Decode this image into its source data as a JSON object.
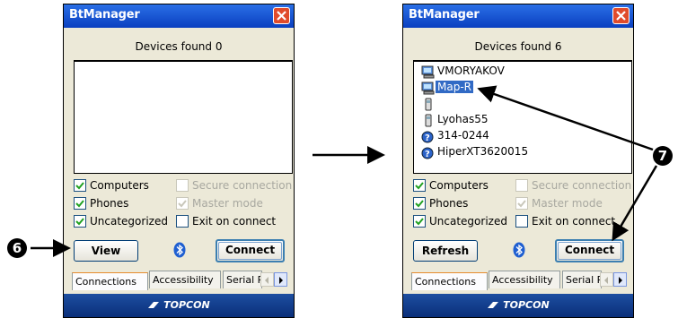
{
  "left_window": {
    "title": "BtManager",
    "devices_found": "Devices found 0",
    "checkboxes": {
      "computers": {
        "label": "Computers",
        "checked": true
      },
      "phones": {
        "label": "Phones",
        "checked": true
      },
      "uncategorized": {
        "label": "Uncategorized",
        "checked": true
      },
      "secure": {
        "label": "Secure connection",
        "checked": false,
        "disabled": true
      },
      "master": {
        "label": "Master mode",
        "checked": true,
        "disabled": true
      },
      "exit": {
        "label": "Exit on connect",
        "checked": false
      }
    },
    "left_button": "View",
    "connect_button": "Connect",
    "tabs": [
      "Connections",
      "Accessibility",
      "Serial P"
    ],
    "footer_logo": "TOPCON"
  },
  "right_window": {
    "title": "BtManager",
    "devices_found": "Devices found 6",
    "devices": [
      {
        "name": "VMORYAKOV",
        "icon": "computer-icon",
        "selected": false
      },
      {
        "name": "Map-R",
        "icon": "computer-icon",
        "selected": true
      },
      {
        "name": "",
        "icon": "phone-icon",
        "selected": false
      },
      {
        "name": "Lyohas55",
        "icon": "phone-icon",
        "selected": false
      },
      {
        "name": "314-0244",
        "icon": "unknown-device-icon",
        "selected": false
      },
      {
        "name": "HiperXT3620015",
        "icon": "unknown-device-icon",
        "selected": false
      }
    ],
    "checkboxes": {
      "computers": {
        "label": "Computers",
        "checked": true
      },
      "phones": {
        "label": "Phones",
        "checked": true
      },
      "uncategorized": {
        "label": "Uncategorized",
        "checked": true
      },
      "secure": {
        "label": "Secure connection",
        "checked": false,
        "disabled": true
      },
      "master": {
        "label": "Master mode",
        "checked": true,
        "disabled": true
      },
      "exit": {
        "label": "Exit on connect",
        "checked": false
      }
    },
    "left_button": "Refresh",
    "connect_button": "Connect",
    "tabs": [
      "Connections",
      "Accessibility",
      "Serial P"
    ],
    "footer_logo": "TOPCON"
  },
  "annotations": {
    "marker_6": "6",
    "marker_7": "7"
  },
  "colors": {
    "titlebar": "#0a3fc0",
    "selection": "#316ac5",
    "close": "#e04b2b"
  }
}
